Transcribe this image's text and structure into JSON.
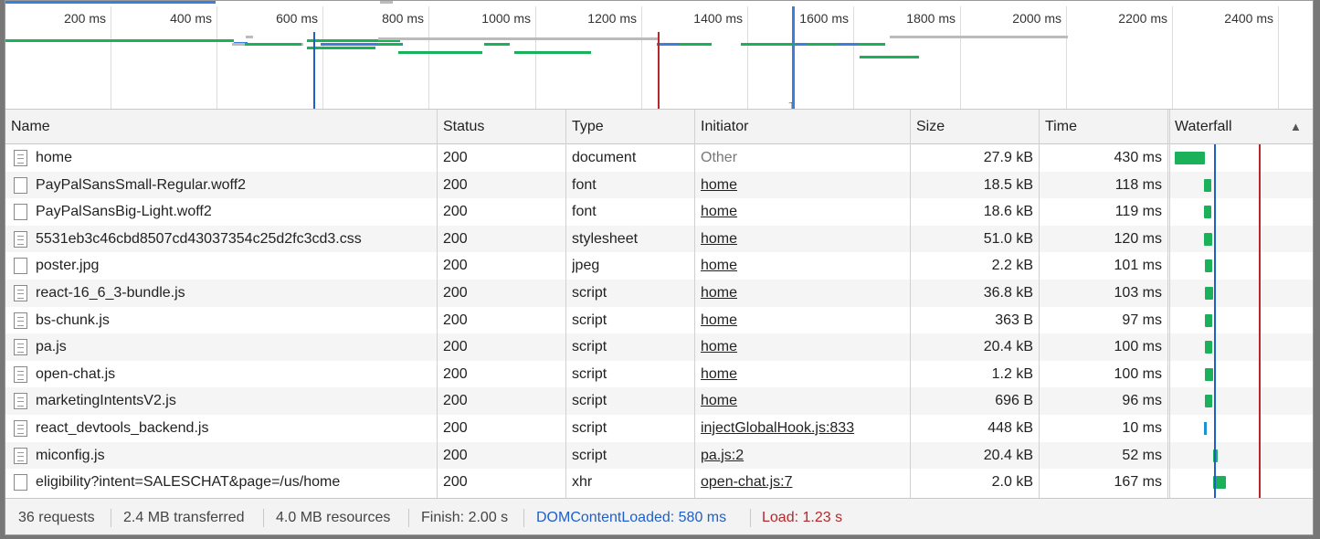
{
  "overview": {
    "ticks": [
      "200 ms",
      "400 ms",
      "600 ms",
      "800 ms",
      "1000 ms",
      "1200 ms",
      "1400 ms",
      "1600 ms",
      "1800 ms",
      "2000 ms",
      "2200 ms",
      "2400 ms"
    ]
  },
  "columns": {
    "name": "Name",
    "status": "Status",
    "type": "Type",
    "initiator": "Initiator",
    "size": "Size",
    "time": "Time",
    "waterfall": "Waterfall",
    "sort_icon": "▲"
  },
  "rows": [
    {
      "name": "home",
      "status": "200",
      "type": "document",
      "initiator": "Other",
      "size": "27.9 kB",
      "time": "430 ms",
      "icon": "document-icon"
    },
    {
      "name": "PayPalSansSmall-Regular.woff2",
      "status": "200",
      "type": "font",
      "initiator": "home",
      "size": "18.5 kB",
      "time": "118 ms",
      "icon": "file-icon"
    },
    {
      "name": "PayPalSansBig-Light.woff2",
      "status": "200",
      "type": "font",
      "initiator": "home",
      "size": "18.6 kB",
      "time": "119 ms",
      "icon": "file-icon"
    },
    {
      "name": "5531eb3c46cbd8507cd43037354c25d2fc3cd3.css",
      "status": "200",
      "type": "stylesheet",
      "initiator": "home",
      "size": "51.0 kB",
      "time": "120 ms",
      "icon": "document-icon"
    },
    {
      "name": "poster.jpg",
      "status": "200",
      "type": "jpeg",
      "initiator": "home",
      "size": "2.2 kB",
      "time": "101 ms",
      "icon": "file-icon"
    },
    {
      "name": "react-16_6_3-bundle.js",
      "status": "200",
      "type": "script",
      "initiator": "home",
      "size": "36.8 kB",
      "time": "103 ms",
      "icon": "document-icon"
    },
    {
      "name": "bs-chunk.js",
      "status": "200",
      "type": "script",
      "initiator": "home",
      "size": "363 B",
      "time": "97 ms",
      "icon": "document-icon"
    },
    {
      "name": "pa.js",
      "status": "200",
      "type": "script",
      "initiator": "home",
      "size": "20.4 kB",
      "time": "100 ms",
      "icon": "document-icon"
    },
    {
      "name": "open-chat.js",
      "status": "200",
      "type": "script",
      "initiator": "home",
      "size": "1.2 kB",
      "time": "100 ms",
      "icon": "document-icon"
    },
    {
      "name": "marketingIntentsV2.js",
      "status": "200",
      "type": "script",
      "initiator": "home",
      "size": "696 B",
      "time": "96 ms",
      "icon": "document-icon"
    },
    {
      "name": "react_devtools_backend.js",
      "status": "200",
      "type": "script",
      "initiator": "injectGlobalHook.js:833",
      "size": "448 kB",
      "time": "10 ms",
      "icon": "document-icon"
    },
    {
      "name": "miconfig.js",
      "status": "200",
      "type": "script",
      "initiator": "pa.js:2",
      "size": "20.4 kB",
      "time": "52 ms",
      "icon": "document-icon"
    },
    {
      "name": "eligibility?intent=SALESCHAT&page=/us/home",
      "status": "200",
      "type": "xhr",
      "initiator": "open-chat.js:7",
      "size": "2.0 kB",
      "time": "167 ms",
      "icon": "file-icon"
    }
  ],
  "status_bar": {
    "requests": "36 requests",
    "transferred": "2.4 MB transferred",
    "resources": "4.0 MB resources",
    "finish": "Finish: 2.00 s",
    "dom_content_loaded": "DOMContentLoaded: 580 ms",
    "load": "Load: 1.23 s"
  },
  "colors": {
    "dom_content_loaded": "#1f5fc9",
    "load": "#b3282d",
    "bar_green": "#1bb15a",
    "bar_gray": "#bbbbbb",
    "bar_blue": "#3b7fd8"
  }
}
